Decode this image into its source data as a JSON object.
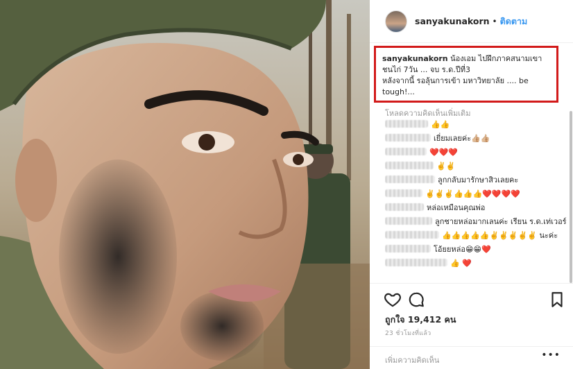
{
  "header": {
    "username": "sanyakunakorn",
    "separator": "•",
    "follow_label": "ติดตาม"
  },
  "caption": {
    "username": "sanyakunakorn",
    "text_line1": " น้องเอม ไปฝึกภาคสนามเขาชนไก่ 7วัน ... จบ ร.ด.ปีที่3",
    "text_line2": "หลังจากนี้ รอลุ้นการเข้า มหาวิทยาลัย .... be tough!..."
  },
  "load_more_label": "โหลดความคิดเห็นเพิ่มเติม",
  "comments": [
    {
      "text": "👍👍"
    },
    {
      "text": "เยี่ยมเลยค่ะ👍🏼👍🏼"
    },
    {
      "text": "❤️❤️❤️"
    },
    {
      "text": "✌️✌️"
    },
    {
      "text": "ลูกกลับมารักษาสิวเลยคะ"
    },
    {
      "text": "✌️✌️✌️👍👍👍❤️❤️❤️❤️"
    },
    {
      "text": "หล่อเหมือนคุณพ่อ"
    },
    {
      "text": "ลูกชายหล่อมากเลนค่ะ เรียน ร.ด.เท่เวอร์"
    },
    {
      "text": "👍👍👍👍👍✌️✌️✌️✌️✌️ นะค่ะ"
    },
    {
      "text": "โอ้ยยหล่อ😁😁❤️"
    },
    {
      "text": "👍 ❤️"
    }
  ],
  "likes_text": "ถูกใจ 19,412 คน",
  "time_text": "23 ชั่วโมงที่แล้ว",
  "add_comment_placeholder": "เพิ่มความคิดเห็น",
  "more_options": "•••",
  "icons": {
    "like": "heart-icon",
    "comment": "comment-icon",
    "save": "bookmark-icon"
  },
  "colors": {
    "follow": "#3897f0",
    "highlight_box": "#d21a1a"
  }
}
